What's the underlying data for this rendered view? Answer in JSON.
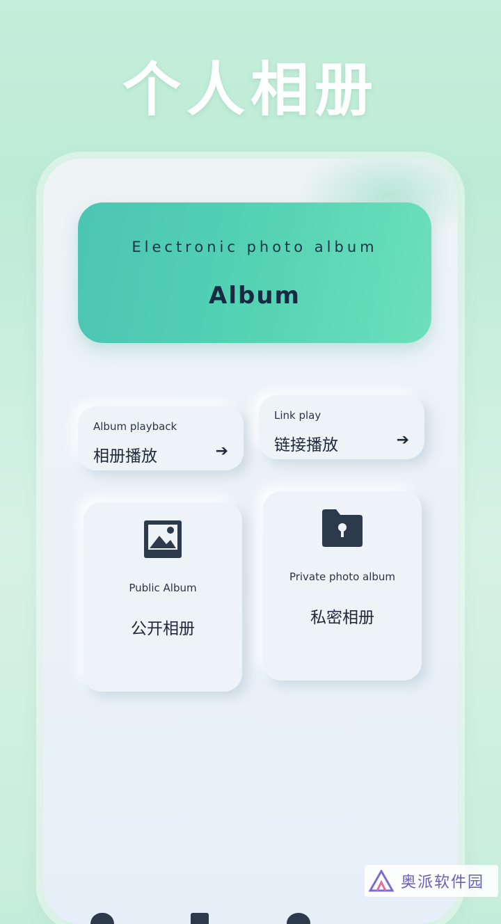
{
  "hero": {
    "title": "个人相册"
  },
  "banner": {
    "subtitle": "Electronic photo album",
    "title": "Album"
  },
  "quick_actions": [
    {
      "en": "Album playback",
      "cn": "相册播放",
      "arrow": "➔"
    },
    {
      "en": "Link play",
      "cn": "链接播放",
      "arrow": "➔"
    }
  ],
  "albums": [
    {
      "en": "Public Album",
      "cn": "公开相册",
      "icon": "image-icon"
    },
    {
      "en": "Private photo album",
      "cn": "私密相册",
      "icon": "locked-folder-icon"
    }
  ],
  "bottom_nav": [
    "home-icon",
    "album-icon",
    "profile-icon"
  ],
  "watermark": {
    "text": "奥派软件园"
  },
  "colors": {
    "accent": "#52d1b4",
    "icon": "#2d3a4c",
    "watermark": "#6a5fb8"
  }
}
